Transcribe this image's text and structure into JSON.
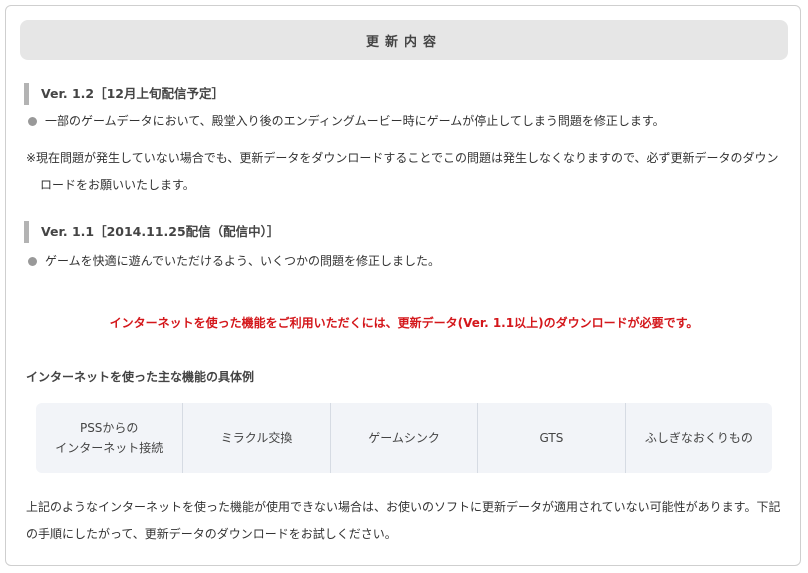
{
  "title": "更新内容",
  "versions": [
    {
      "heading": "Ver. 1.2［12月上旬配信予定］",
      "bullet": "一部のゲームデータにおいて、殿堂入り後のエンディングムービー時にゲームが停止してしまう問題を修正します。"
    },
    {
      "heading": "Ver. 1.1［2014.11.25配信（配信中）］",
      "bullet": "ゲームを快適に遊んでいただけるよう、いくつかの問題を修正しました。"
    }
  ],
  "note": {
    "line1": "※現在問題が発生していない場合でも、更新データをダウンロードすることでこの問題は発生しなくなりますので、必ず更新データのダウン",
    "line2": "ロードをお願いいたします。"
  },
  "notice": "インターネットを使った機能をご利用いただくには、更新データ(Ver. 1.1以上)のダウンロードが必要です。",
  "features_heading": "インターネットを使った主な機能の具体例",
  "features": [
    {
      "line1": "PSSからの",
      "line2": "インターネット接続"
    },
    {
      "line1": "ミラクル交換",
      "line2": ""
    },
    {
      "line1": "ゲームシンク",
      "line2": ""
    },
    {
      "line1": "GTS",
      "line2": ""
    },
    {
      "line1": "ふしぎなおくりもの",
      "line2": ""
    }
  ],
  "closing": {
    "line1": "上記のようなインターネットを使った機能が使用できない場合は、お使いのソフトに更新データが適用されていない可能性があります。下記",
    "line2": "の手順にしたがって、更新データのダウンロードをお試しください。"
  },
  "colors": {
    "notice": "#d4171b",
    "title_bar": "#e6e6e6",
    "heading_bar": "#b3b3b3",
    "table_bg": "#f2f4f8"
  }
}
